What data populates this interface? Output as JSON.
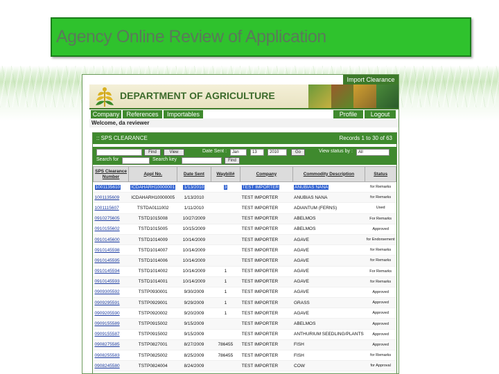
{
  "slide": {
    "title": "Agency Online Review of Application"
  },
  "app": {
    "import_tab": "Import Clearance",
    "dept_title": "DEPARTMENT OF AGRICULTURE",
    "nav": {
      "company": "Company",
      "references": "References",
      "importables": "Importables",
      "profile": "Profile",
      "logout": "Logout"
    },
    "welcome": "Welcome, da reviewer",
    "panel": {
      "title": ":: SPS CLEARANCE",
      "records": "Records 1 to 30 of 63"
    },
    "filters": {
      "find_label": "Find",
      "view_label": "View",
      "date_sent_label": "Date Sent :",
      "month": "Jan",
      "day": "13",
      "year": "2010",
      "go_label": "Go",
      "view_status_label": "View status by :",
      "status_value": "All",
      "search_for_label": "Search for",
      "search_key_label": "Search key",
      "search_button": "Find"
    },
    "columns": [
      "SPS Clearance Number",
      "Appl No.",
      "Date Sent",
      "Waybill#",
      "Company",
      "Commodity Description",
      "Status"
    ],
    "rows": [
      {
        "sps": "1001135610",
        "appl": "ICDAHARH10000001",
        "date": "1/13/2010",
        "waybill": "3",
        "company": "TEST IMPORTER",
        "commodity": "ANUBIAS NANA",
        "status": "for Remarks"
      },
      {
        "sps": "1001135609",
        "appl": "ICDAHARH10000005",
        "date": "1/13/2010",
        "waybill": "",
        "company": "TEST IMPORTER",
        "commodity": "ANUBIAS NANA",
        "status": "for Remarks"
      },
      {
        "sps": "1001115607",
        "appl": "TSTDA0111002",
        "date": "1/11/2010",
        "waybill": "",
        "company": "TEST IMPORTER",
        "commodity": "ADIANTUM (FERNS)",
        "status": "Used"
      },
      {
        "sps": "0910275605",
        "appl": "TSTD1015008",
        "date": "10/27/2009",
        "waybill": "",
        "company": "TEST IMPORTER",
        "commodity": "ABELMOS",
        "status": "For Remarks"
      },
      {
        "sps": "0910155602",
        "appl": "TSTD1015005",
        "date": "10/15/2009",
        "waybill": "",
        "company": "TEST IMPORTER",
        "commodity": "ABELMOS",
        "status": "Approved"
      },
      {
        "sps": "0910145600",
        "appl": "TSTD1014009",
        "date": "10/14/2009",
        "waybill": "",
        "company": "TEST IMPORTER",
        "commodity": "AGAVE",
        "status": "for Endorsement"
      },
      {
        "sps": "0910145598",
        "appl": "TSTD1014007",
        "date": "10/14/2009",
        "waybill": "",
        "company": "TEST IMPORTER",
        "commodity": "AGAVE",
        "status": "for Remarks"
      },
      {
        "sps": "0910145595",
        "appl": "TSTD1014006",
        "date": "10/14/2009",
        "waybill": "",
        "company": "TEST IMPORTER",
        "commodity": "AGAVE",
        "status": "for Remarks"
      },
      {
        "sps": "0910145594",
        "appl": "TSTD1014002",
        "date": "10/14/2009",
        "waybill": "1",
        "company": "TEST IMPORTER",
        "commodity": "AGAVE",
        "status": "For Remarks"
      },
      {
        "sps": "0910145593",
        "appl": "TSTD1014001",
        "date": "10/14/2009",
        "waybill": "1",
        "company": "TEST IMPORTER",
        "commodity": "AGAVE",
        "status": "for Remarks"
      },
      {
        "sps": "0909305592",
        "appl": "TSTP0930001",
        "date": "9/30/2009",
        "waybill": "1",
        "company": "TEST IMPORTER",
        "commodity": "AGAVE",
        "status": "Approved"
      },
      {
        "sps": "0909295591",
        "appl": "TSTP0929001",
        "date": "9/29/2009",
        "waybill": "1",
        "company": "TEST IMPORTER",
        "commodity": "GRASS",
        "status": "Approved"
      },
      {
        "sps": "0909205590",
        "appl": "TSTP0920002",
        "date": "9/20/2009",
        "waybill": "1",
        "company": "TEST IMPORTER",
        "commodity": "AGAVE",
        "status": "Approved"
      },
      {
        "sps": "0909155589",
        "appl": "TSTP0915002",
        "date": "9/15/2009",
        "waybill": "",
        "company": "TEST IMPORTER",
        "commodity": "ABELMOS",
        "status": "Approved"
      },
      {
        "sps": "0909155587",
        "appl": "TSTP0915002",
        "date": "9/15/2009",
        "waybill": "",
        "company": "TEST IMPORTER",
        "commodity": "ANTHURIUM SEEDLING/PLANTS",
        "status": "Approved"
      },
      {
        "sps": "0908275585",
        "appl": "TSTP0827001",
        "date": "8/27/2009",
        "waybill": "786455",
        "company": "TEST IMPORTER",
        "commodity": "FISH",
        "status": "Approved"
      },
      {
        "sps": "0908255583",
        "appl": "TSTP0825002",
        "date": "8/25/2009",
        "waybill": "786455",
        "company": "TEST IMPORTER",
        "commodity": "FISH",
        "status": "for Remarks"
      },
      {
        "sps": "0908245580",
        "appl": "TSTP0824004",
        "date": "8/24/2009",
        "waybill": "",
        "company": "TEST IMPORTER",
        "commodity": "COW",
        "status": "for Approval"
      }
    ]
  }
}
